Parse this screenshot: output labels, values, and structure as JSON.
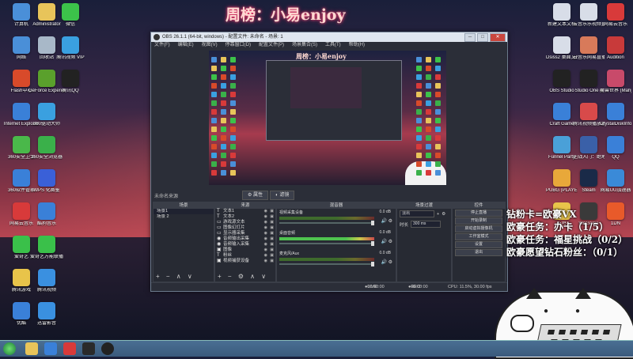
{
  "banner": {
    "title": "周榜：小易enjoy"
  },
  "overlay": {
    "line1": "钻粉卡=欧豪VX",
    "line2": "欧豪任务：办卡（1/5）",
    "line3": "欧豪任务：福星挑战（0/2）",
    "line4": "欧豪愿望钻石粉丝：（0/1）"
  },
  "desktop_left": [
    {
      "label": "计算机",
      "color": "#4a8fd8"
    },
    {
      "label": "Administrator",
      "color": "#e8c45a"
    },
    {
      "label": "微信",
      "color": "#3cc24a"
    },
    {
      "label": "网络",
      "color": "#4a8fd8"
    },
    {
      "label": "回收站",
      "color": "#a8b8c8"
    },
    {
      "label": "腾讯视频 VIP",
      "color": "#3aa0e0"
    },
    {
      "label": "Flash中心",
      "color": "#d84a2a"
    },
    {
      "label": "GeForce Experience",
      "color": "#5aa02c"
    },
    {
      "label": "腾讯QQ",
      "color": "#222222"
    },
    {
      "label": "Internet Explorer",
      "color": "#3a80d8"
    },
    {
      "label": "360驱动大师",
      "color": "#3aa0e0"
    },
    {
      "label": "",
      "color": "#000000"
    },
    {
      "label": "360安全卫士",
      "color": "#4ab84a"
    },
    {
      "label": "360安全浏览器",
      "color": "#3ab04a"
    },
    {
      "label": "",
      "color": "#000000"
    },
    {
      "label": "360软件管家",
      "color": "#3a80d8"
    },
    {
      "label": "WPS 化图鉴",
      "color": "#3a60d8"
    },
    {
      "label": "",
      "color": "#000000"
    },
    {
      "label": "网易云音乐",
      "color": "#d83a3a"
    },
    {
      "label": "酷狗音乐",
      "color": "#3a80d8"
    },
    {
      "label": "",
      "color": "#000000"
    },
    {
      "label": "爱奇艺",
      "color": "#3ac04a"
    },
    {
      "label": "爱奇艺万能联播",
      "color": "#3ac04a"
    },
    {
      "label": "",
      "color": "#000000"
    },
    {
      "label": "腾讯游戏",
      "color": "#e8c44a"
    },
    {
      "label": "腾讯视频",
      "color": "#3a90e0"
    },
    {
      "label": "",
      "color": "#000000"
    },
    {
      "label": "优酷",
      "color": "#3a80d8"
    },
    {
      "label": "迅雷影音",
      "color": "#3a90e0"
    }
  ],
  "desktop_right": [
    {
      "label": "新建文本文档",
      "color": "#d8dde8"
    },
    {
      "label": "云音乐乐视频直播",
      "color": "#d8dde8"
    },
    {
      "label": "网易云音乐",
      "color": "#d83a3a"
    },
    {
      "label": "Dsiss2 桌面文件",
      "color": "#d8dde8"
    },
    {
      "label": "云音乐网易直播",
      "color": "#d87a5a"
    },
    {
      "label": "Audition",
      "color": "#c83a3a"
    },
    {
      "label": "OBS Studio",
      "color": "#222222"
    },
    {
      "label": "Studio One 4",
      "color": "#222222"
    },
    {
      "label": "魔兽世界 (Mahjong)",
      "color": "#c84a6a"
    },
    {
      "label": "Craft Game",
      "color": "#3a80d8"
    },
    {
      "label": "腾讯视频播放器",
      "color": "#d84a4a"
    },
    {
      "label": "CrystalDiskInfo",
      "color": "#3a80d8"
    },
    {
      "label": "Funnel Party",
      "color": "#4aa0d8"
    },
    {
      "label": "逆战入门：绝地求生",
      "color": "#3a60a8"
    },
    {
      "label": "QQ",
      "color": "#3a80d8"
    },
    {
      "label": "PUBG (PLAYERU...)",
      "color": "#e8a83a"
    },
    {
      "label": "Steam",
      "color": "#1a2a48"
    },
    {
      "label": "网易UU加速器",
      "color": "#3a8ad8"
    },
    {
      "label": "吃鸡",
      "color": "#e8c44a"
    },
    {
      "label": "WeGame",
      "color": "#3a3a3a"
    },
    {
      "label": "1DN",
      "color": "#e85a2a"
    }
  ],
  "obs": {
    "window_title": "OBS 26.1.1 (64-bit, windows) - 配置文件: 未命名 - 场景: 1",
    "menu": [
      "文件(F)",
      "编辑(E)",
      "视图(V)",
      "停靠窗口(D)",
      "配置文件(P)",
      "场景集合(S)",
      "工具(T)",
      "帮助(H)"
    ],
    "win_min": "─",
    "win_max": "□",
    "win_close": "✕",
    "preview_title": "周榜：小易enjoy",
    "status_label": "未命名来源",
    "tab_properties": "属性",
    "tab_filters": "滤镜",
    "scenes": {
      "header": "场景",
      "items": [
        "场景1",
        "场景 2"
      ]
    },
    "sources": {
      "header": "来源",
      "items": [
        {
          "icon": "T",
          "label": "文本1"
        },
        {
          "icon": "T",
          "label": "文本2"
        },
        {
          "icon": "▭",
          "label": "游戏源文本"
        },
        {
          "icon": "▭",
          "label": "图像幻灯片"
        },
        {
          "icon": "▭",
          "label": "显示器采集"
        },
        {
          "icon": "◉",
          "label": "音频输出采集"
        },
        {
          "icon": "◉",
          "label": "音频输入采集"
        },
        {
          "icon": "▣",
          "label": "图像"
        },
        {
          "icon": "T",
          "label": "粉丝"
        },
        {
          "icon": "▣",
          "label": "视频捕获设备"
        }
      ]
    },
    "mixer": {
      "header": "混音器",
      "channels": [
        {
          "name": "视频采集设备",
          "db": "0.0 dB"
        },
        {
          "name": "桌面音频",
          "db": "0.0 dB"
        },
        {
          "name": "麦克风/Aux",
          "db": "0.0 dB"
        }
      ]
    },
    "transitions": {
      "header": "场景过渡",
      "selected": "淡出",
      "duration_label": "时长",
      "duration": "300 ms"
    },
    "controls": {
      "header": "控件",
      "buttons": [
        "停止直播",
        "开始录制",
        "启动虚拟摄像机",
        "工作室模式",
        "设置",
        "退出"
      ]
    },
    "statusbar": {
      "live_label": "LIVE:",
      "live_time": "00:00:00",
      "rec_label": "REC:",
      "rec_time": "00:00:00",
      "cpu": "CPU: 11.5%, 30.00 fps"
    }
  },
  "taskbar": {
    "items": [
      "start",
      "explorer",
      "ie",
      "netease",
      "lol",
      "obs"
    ]
  }
}
